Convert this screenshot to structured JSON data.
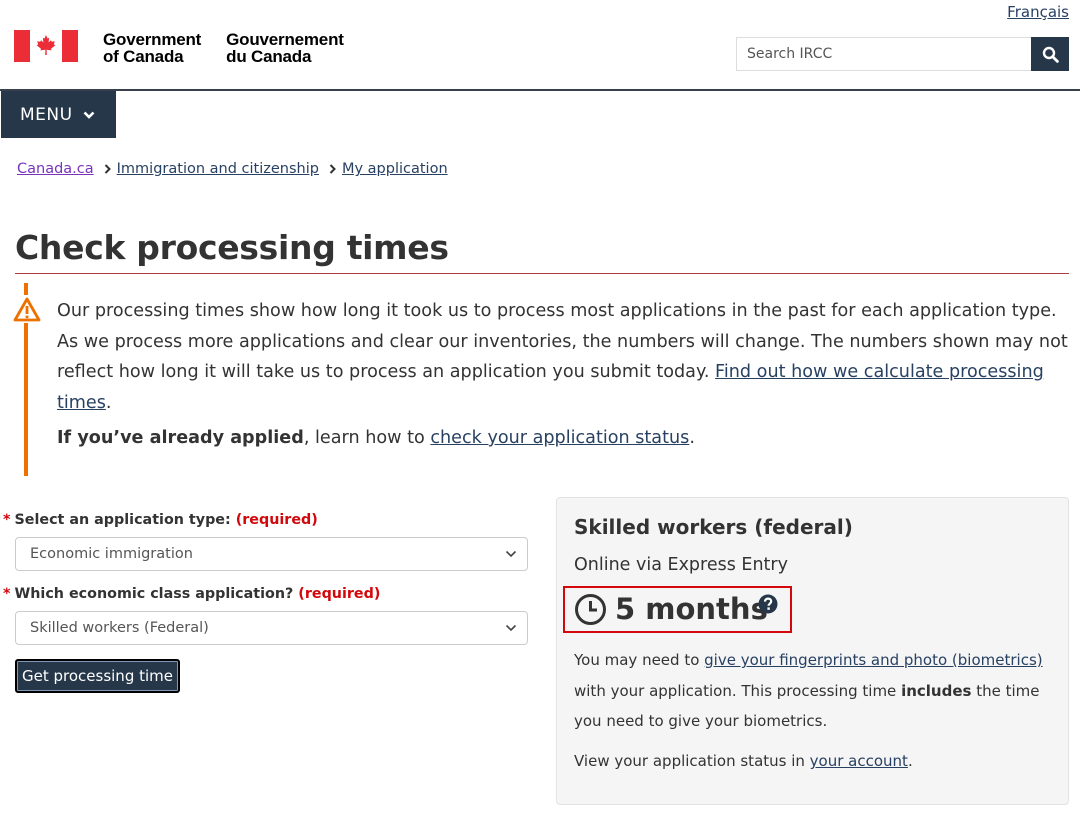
{
  "header": {
    "language_link": "Français",
    "gov_en_line1": "Government",
    "gov_en_line2": "of Canada",
    "gov_fr_line1": "Gouvernement",
    "gov_fr_line2": "du Canada",
    "search_placeholder": "Search IRCC",
    "menu_label": "MENU",
    "colors": {
      "flag_red": "#eb2d37",
      "nav_dark": "#26374a"
    }
  },
  "breadcrumb": [
    {
      "label": "Canada.ca"
    },
    {
      "label": "Immigration and citizenship"
    },
    {
      "label": "My application"
    }
  ],
  "page": {
    "title": "Check processing times"
  },
  "notice": {
    "text": "Our processing times show how long it took us to process most applications in the past for each application type. As we process more applications and clear our inventories, the numbers will change. The numbers shown may not reflect how long it will take us to process an application you submit today. ",
    "link": "Find out how we calculate processing times",
    "end": ".",
    "applied_bold": "If you’ve already applied",
    "applied_text": ", learn how to ",
    "applied_link": "check your application status",
    "applied_end": "."
  },
  "form": {
    "app_type_label": "Select an application type:",
    "app_type_required": "(required)",
    "app_type_value": "Economic immigration",
    "class_label": "Which economic class application?",
    "class_required": "(required)",
    "class_value": "Skilled workers (Federal)",
    "submit_label": "Get processing time"
  },
  "result": {
    "title": "Skilled workers (federal)",
    "subtitle": "Online via Express Entry",
    "time": "5 months",
    "bio_text1": "You may need to ",
    "bio_link": "give your fingerprints and photo (biometrics)",
    "bio_text2": " with your application. This processing time ",
    "bio_bold": "includes",
    "bio_text3": " the time you need to give your biometrics.",
    "account_text": "View your application status in ",
    "account_link": "your account",
    "account_end": "."
  }
}
